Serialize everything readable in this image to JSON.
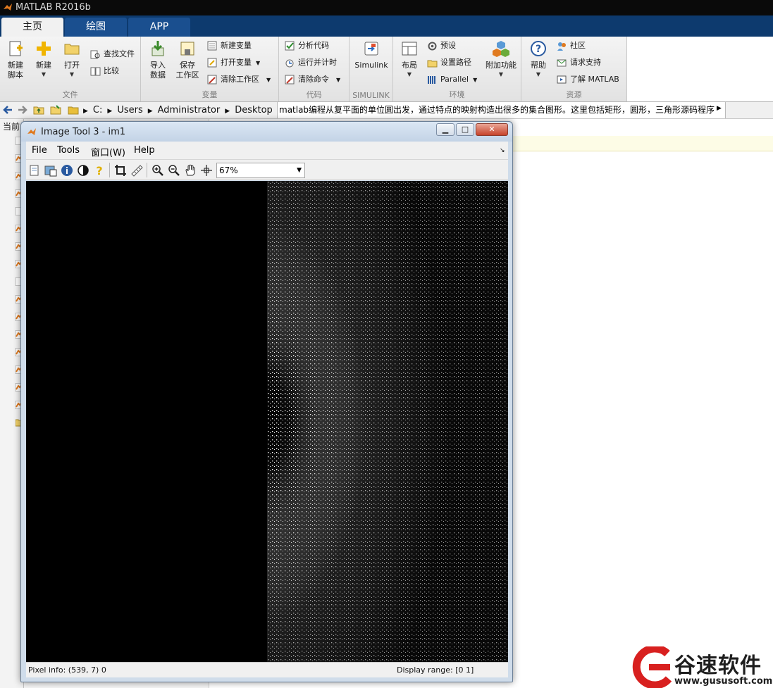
{
  "app": {
    "title": "MATLAB R2016b"
  },
  "tabs": [
    {
      "label": "主页"
    },
    {
      "label": "绘图"
    },
    {
      "label": "APP"
    }
  ],
  "ribbon": {
    "file": {
      "title": "文件",
      "new_script": "新建\n脚本",
      "new": "新建",
      "open": "打开",
      "find_files": "查找文件",
      "compare": "比较"
    },
    "variable": {
      "title": "变量",
      "import_data": "导入\n数据",
      "save_workspace": "保存\n工作区",
      "new_variable": "新建变量",
      "open_variable": "打开变量",
      "clear_workspace": "清除工作区"
    },
    "code": {
      "title": "代码",
      "analyze_code": "分析代码",
      "run_and_time": "运行并计时",
      "clear_commands": "清除命令"
    },
    "simulink": {
      "title": "SIMULINK",
      "simulink": "Simulink"
    },
    "environment": {
      "title": "环境",
      "layout": "布局",
      "preferences": "预设",
      "set_path": "设置路径",
      "parallel": "Parallel",
      "addons": "附加功能"
    },
    "resources": {
      "title": "资源",
      "help": "帮助",
      "community": "社区",
      "request_support": "请求支持",
      "learn_matlab": "了解 MATLAB"
    }
  },
  "address": {
    "crumbs": [
      "C:",
      "Users",
      "Administrator",
      "Desktop"
    ],
    "path": "matlab编程从复平面的单位圆出发，通过特点的映射构造出很多的集合图形。这里包括矩形，圆形，三角形源码程序"
  },
  "current_folder": {
    "header": "当前"
  },
  "imtool": {
    "title": "Image Tool 3 - im1",
    "menus": [
      "File",
      "Tools",
      "窗口(W)",
      "Help"
    ],
    "zoom": "67%",
    "pixel_info": "Pixel info: (539, 7)  0",
    "display_range": "Display range: [0 1]"
  },
  "watermark": {
    "brand": "谷速软件",
    "url": "www.gususoft.com"
  },
  "colors": {
    "tab_bar": "#0d3a6e",
    "title_bar": "#0a0a0a",
    "image_background": "#000000",
    "image_points": "#ffffff",
    "watermark_red": "#d8201f"
  }
}
